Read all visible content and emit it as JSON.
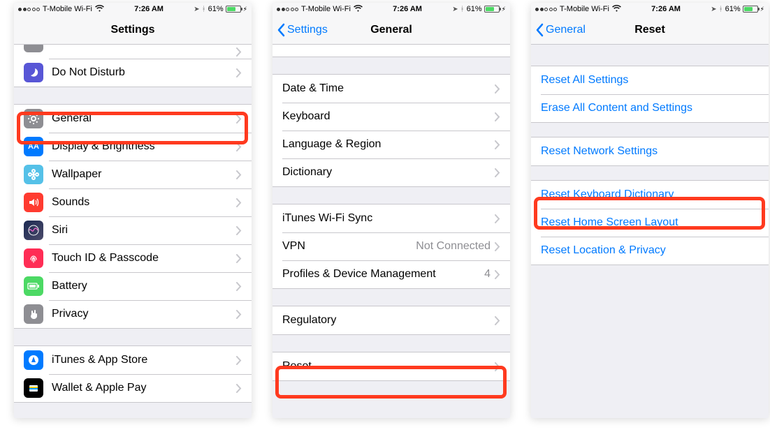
{
  "status": {
    "carrier": "T-Mobile Wi-Fi",
    "time": "7:26 AM",
    "battery_pct": "61%"
  },
  "screen1": {
    "title": "Settings",
    "group1": [
      {
        "label": "Do Not Disturb"
      }
    ],
    "group2": [
      {
        "label": "General"
      },
      {
        "label": "Display & Brightness"
      },
      {
        "label": "Wallpaper"
      },
      {
        "label": "Sounds"
      },
      {
        "label": "Siri"
      },
      {
        "label": "Touch ID & Passcode"
      },
      {
        "label": "Battery"
      },
      {
        "label": "Privacy"
      }
    ],
    "group3": [
      {
        "label": "iTunes & App Store"
      },
      {
        "label": "Wallet & Apple Pay"
      }
    ]
  },
  "screen2": {
    "back": "Settings",
    "title": "General",
    "group1": [
      {
        "label": "Date & Time"
      },
      {
        "label": "Keyboard"
      },
      {
        "label": "Language & Region"
      },
      {
        "label": "Dictionary"
      }
    ],
    "group2": [
      {
        "label": "iTunes Wi-Fi Sync"
      },
      {
        "label": "VPN",
        "detail": "Not Connected"
      },
      {
        "label": "Profiles & Device Management",
        "detail": "4"
      }
    ],
    "group3": [
      {
        "label": "Regulatory"
      }
    ],
    "group4": [
      {
        "label": "Reset"
      }
    ]
  },
  "screen3": {
    "back": "General",
    "title": "Reset",
    "group1": [
      {
        "label": "Reset All Settings"
      },
      {
        "label": "Erase All Content and Settings"
      }
    ],
    "group2": [
      {
        "label": "Reset Network Settings"
      }
    ],
    "group3": [
      {
        "label": "Reset Keyboard Dictionary"
      },
      {
        "label": "Reset Home Screen Layout"
      },
      {
        "label": "Reset Location & Privacy"
      }
    ]
  }
}
